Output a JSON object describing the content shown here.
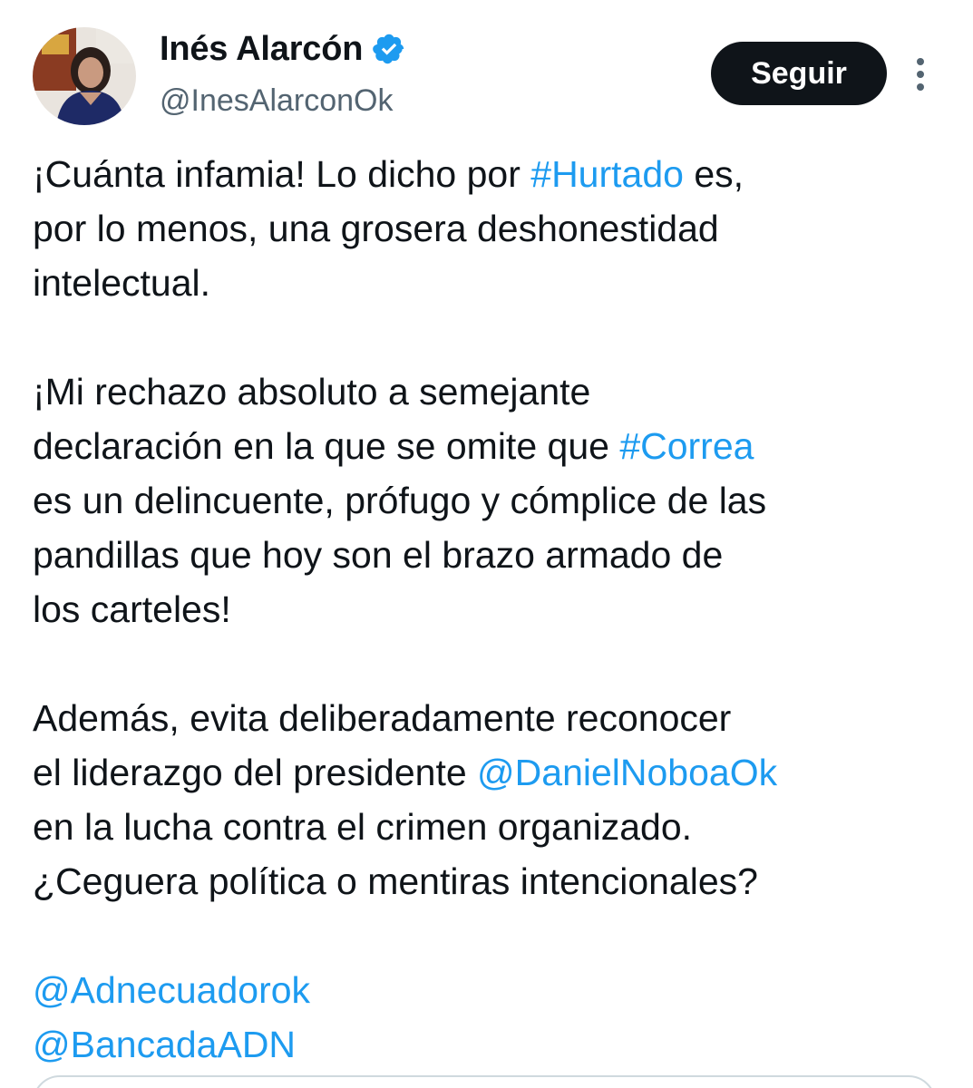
{
  "author": {
    "display_name": "Inés Alarcón",
    "handle": "@InesAlarconOk",
    "verified": true,
    "avatar_icon": "profile-photo"
  },
  "actions": {
    "follow_label": "Seguir",
    "more_icon": "more-vertical-icon"
  },
  "colors": {
    "link": "#1d9bf0",
    "text": "#0f1419",
    "muted": "#536471",
    "button_bg": "#0f1419"
  },
  "tweet": {
    "p1": {
      "l1_a": "¡Cuánta infamia! Lo dicho por ",
      "l1_link": "#Hurtado",
      "l1_b": " es,",
      "l2": "por lo menos, una grosera deshonestidad",
      "l3": "intelectual."
    },
    "p2": {
      "l1": "¡Mi rechazo absoluto a semejante",
      "l2_a": "declaración en la que se omite que ",
      "l2_link": "#Correa",
      "l3": "es un delincuente, prófugo y cómplice de las",
      "l4": "pandillas que hoy son el brazo armado de",
      "l5": "los carteles!"
    },
    "p3": {
      "l1": "Además, evita deliberadamente reconocer",
      "l2_a": "el liderazgo del presidente ",
      "l2_link": "@DanielNoboaOk",
      "l3": "en la lucha contra el crimen organizado.",
      "l4": "¿Ceguera política o mentiras intencionales?"
    },
    "mentions": [
      "@Adnecuadorok",
      "@BancadaADN"
    ]
  }
}
